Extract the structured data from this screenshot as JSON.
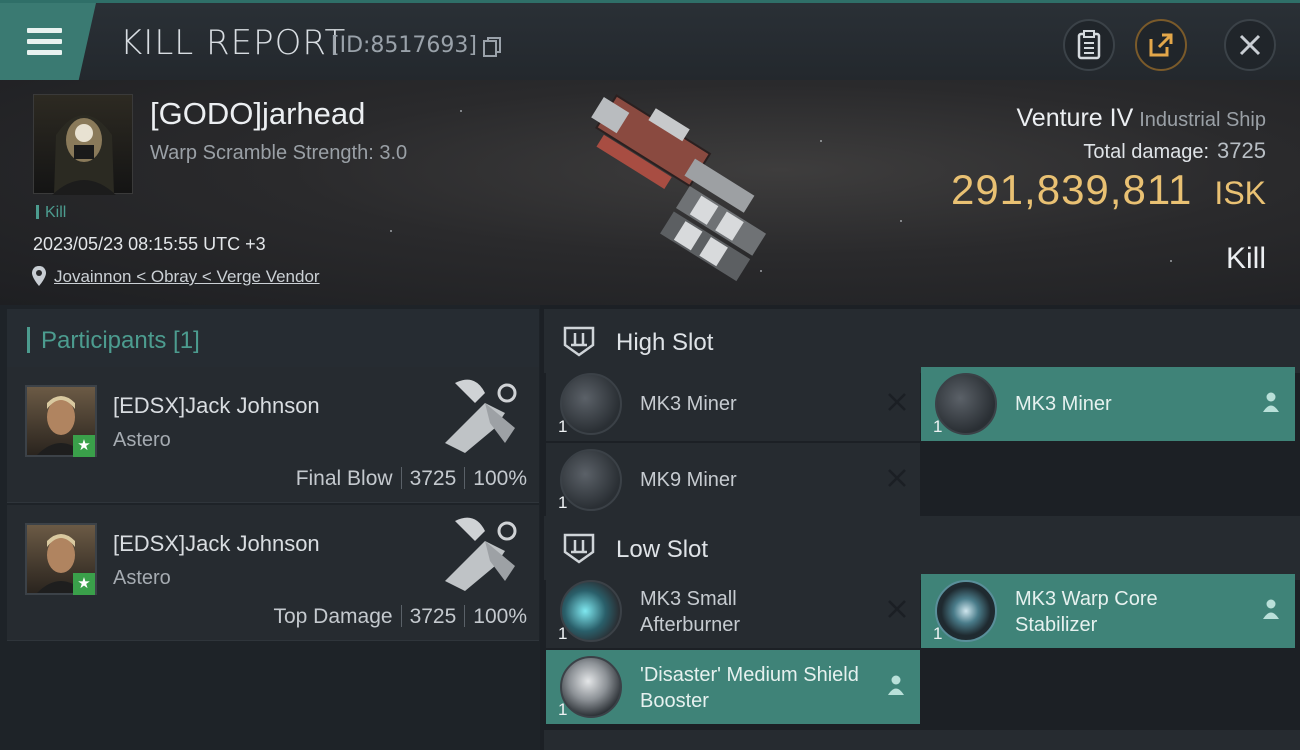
{
  "header": {
    "title": "KILL REPORT",
    "report_id": "[ID:8517693]",
    "icons": [
      "menu-icon",
      "copy-icon",
      "clipboard-icon",
      "share-icon",
      "close-icon"
    ]
  },
  "victim": {
    "name": "[GODO]jarhead",
    "warp_scramble": "Warp Scramble Strength: 3.0",
    "tag": "Kill",
    "timestamp": "2023/05/23 08:15:55 UTC +3",
    "location": "Jovainnon < Obray < Verge Vendor",
    "ship_name": "Venture IV",
    "ship_class": "Industrial Ship",
    "total_damage_label": "Total damage:",
    "total_damage": "3725",
    "isk_value": "291,839,811",
    "isk_unit": "ISK",
    "kill_type": "Kill"
  },
  "participants": {
    "title": "Participants [1]",
    "rows": [
      {
        "name": "[EDSX]Jack Johnson",
        "ship": "Astero",
        "role": "Final Blow",
        "damage": "3725",
        "percent": "100%"
      },
      {
        "name": "[EDSX]Jack Johnson",
        "ship": "Astero",
        "role": "Top Damage",
        "damage": "3725",
        "percent": "100%"
      }
    ]
  },
  "fitting": {
    "high_slot": {
      "title": "High Slot",
      "modules": [
        {
          "name": "MK3 Miner",
          "qty": "1",
          "status": "destroyed"
        },
        {
          "name": "MK3 Miner",
          "qty": "1",
          "status": "dropped"
        },
        {
          "name": "MK9 Miner",
          "qty": "1",
          "status": "destroyed"
        }
      ]
    },
    "low_slot": {
      "title": "Low Slot",
      "modules": [
        {
          "name": "MK3 Small Afterburner",
          "qty": "1",
          "status": "destroyed"
        },
        {
          "name": "MK3 Warp Core Stabilizer",
          "qty": "1",
          "status": "dropped"
        },
        {
          "name": "'Disaster' Medium Shield Booster",
          "qty": "1",
          "status": "dropped"
        }
      ]
    }
  },
  "colors": {
    "accent_teal": "#3f8378",
    "isk_gold": "#e9c173",
    "background": "#1b1f24"
  }
}
